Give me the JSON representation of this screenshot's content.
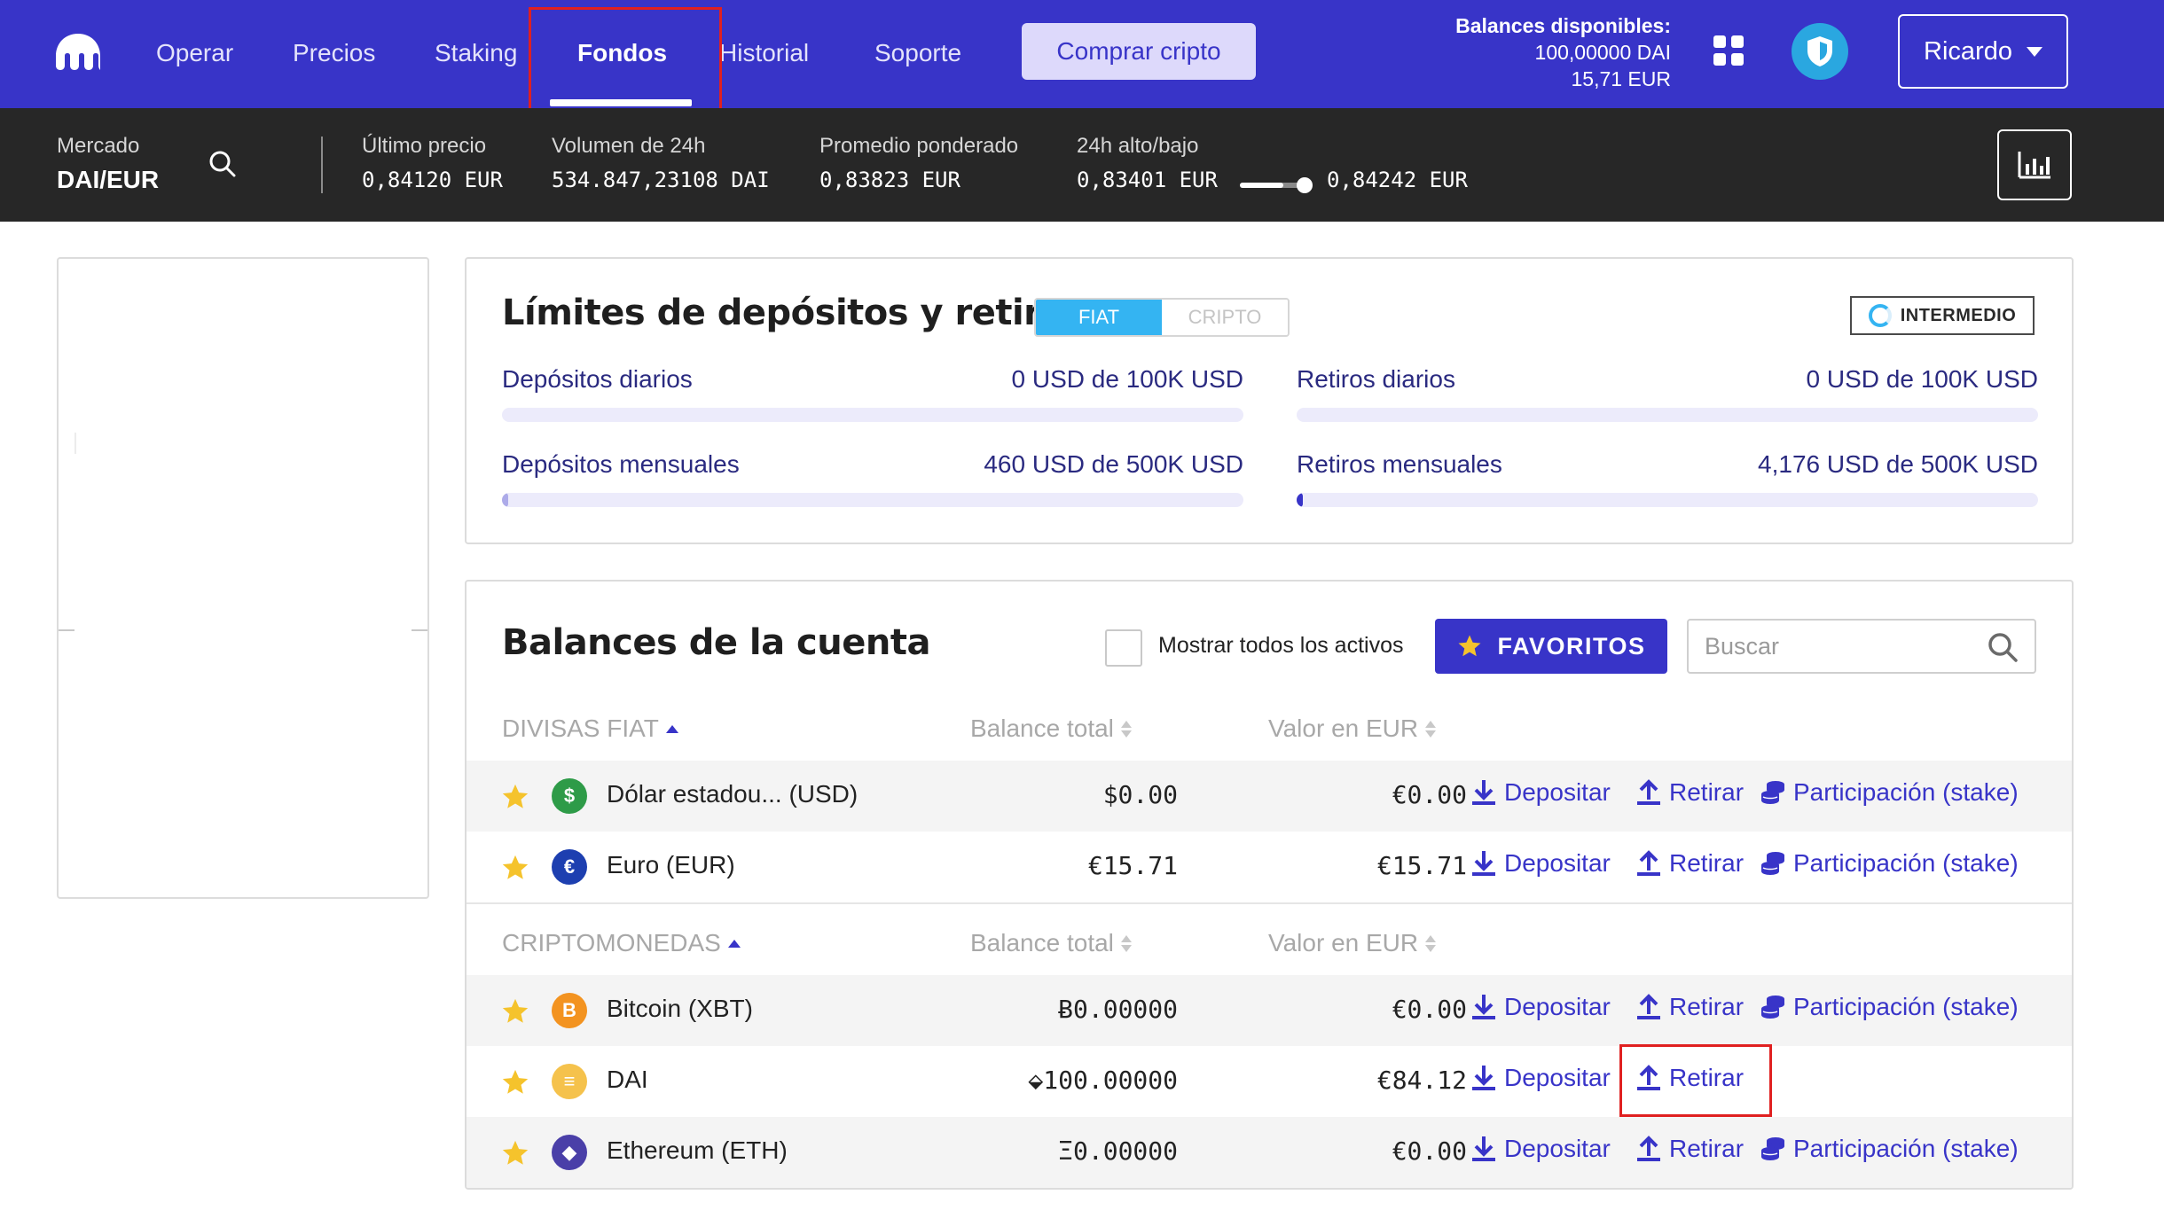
{
  "nav": {
    "items": [
      "Operar",
      "Precios",
      "Staking",
      "Fondos",
      "Historial",
      "Soporte"
    ],
    "active": "Fondos",
    "buy_label": "Comprar cripto",
    "balances_title": "Balances disponibles:",
    "balance_dai": "100,00000 DAI",
    "balance_eur": "15,71 EUR",
    "user": "Ricardo"
  },
  "ticker": {
    "market_label": "Mercado",
    "market_pair": "DAI/EUR",
    "last_price_label": "Último precio",
    "last_price": "0,84120 EUR",
    "volume_label": "Volumen de 24h",
    "volume": "534.847,23108 DAI",
    "vwap_label": "Promedio ponderado",
    "vwap": "0,83823 EUR",
    "range_label": "24h alto/bajo",
    "low": "0,83401 EUR",
    "high": "0,84242 EUR",
    "range_position": 0.85
  },
  "limits": {
    "title": "Límites de depósitos y retiros",
    "tabs": [
      "FIAT",
      "CRIPTO"
    ],
    "active_tab": "FIAT",
    "level": "INTERMEDIO",
    "rows": [
      {
        "name": "Depósitos diarios",
        "used": "0 USD",
        "sep": "de",
        "max": "100K USD",
        "fraction": 0
      },
      {
        "name": "Retiros diarios",
        "used": "0 USD",
        "sep": "de",
        "max": "100K USD",
        "fraction": 0
      },
      {
        "name": "Depósitos mensuales",
        "used": "460 USD",
        "sep": "de",
        "max": "500K USD",
        "fraction": 0.00092
      },
      {
        "name": "Retiros mensuales",
        "used": "4,176 USD",
        "sep": "de",
        "max": "500K USD",
        "fraction": 0.0084
      }
    ]
  },
  "balances": {
    "title": "Balances de la cuenta",
    "show_all_label": "Mostrar todos los activos",
    "favorites_label": "FAVORITOS",
    "search_placeholder": "Buscar",
    "col_total": "Balance total",
    "col_eur": "Valor en EUR",
    "fiat_header": "DIVISAS FIAT",
    "crypto_header": "CRIPTOMONEDAS",
    "deposit_label": "Depositar",
    "withdraw_label": "Retirar",
    "stake_label": "Participación (stake)",
    "fiat": [
      {
        "name": "Dólar estadou...  (USD)",
        "total": "$0.00",
        "eur": "€0.00",
        "coin": "usd-coin-icon",
        "color": "#2e9b48",
        "symbol": "$",
        "stake": true
      },
      {
        "name": "Euro (EUR)",
        "total": "€15.71",
        "eur": "€15.71",
        "coin": "eur-coin-icon",
        "color": "#1d3fb0",
        "symbol": "€",
        "stake": true
      }
    ],
    "crypto": [
      {
        "name": "Bitcoin (XBT)",
        "total": "Ƀ0.00000",
        "eur": "€0.00",
        "coin": "bitcoin-coin-icon",
        "color": "#f39320",
        "symbol": "B",
        "stake": true
      },
      {
        "name": "DAI",
        "total": "⬙100.00000",
        "eur": "€84.12",
        "coin": "dai-coin-icon",
        "color": "#f5c24c",
        "symbol": "≡",
        "stake": false
      },
      {
        "name": "Ethereum (ETH)",
        "total": "Ξ0.00000",
        "eur": "€0.00",
        "coin": "ethereum-coin-icon",
        "color": "#4a3fa8",
        "symbol": "◆",
        "stake": true
      }
    ]
  },
  "colors": {
    "brand": "#3834c8",
    "ticker_bg": "#272727",
    "highlight": "#e02020",
    "fiat_tab": "#34b4f2",
    "star": "#f5c32c"
  }
}
